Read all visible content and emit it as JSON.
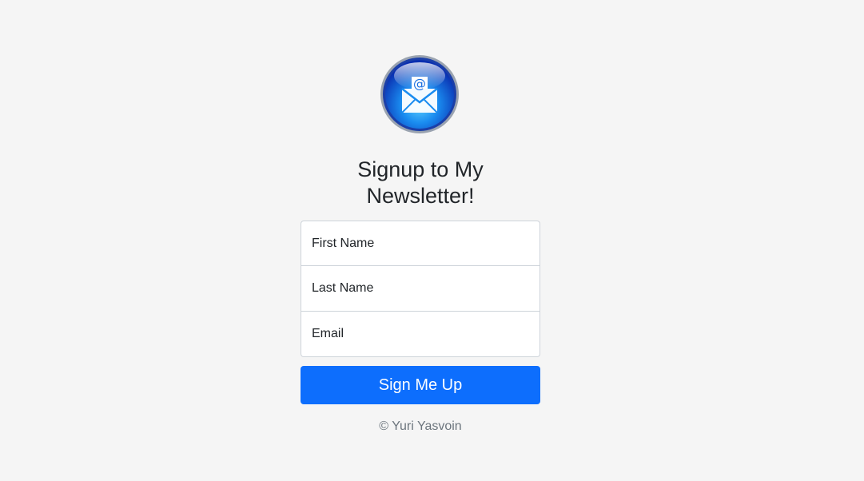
{
  "heading": {
    "line1": "Signup to My",
    "line2": "Newsletter!"
  },
  "form": {
    "first_name_placeholder": "First Name",
    "last_name_placeholder": "Last Name",
    "email_placeholder": "Email",
    "submit_label": "Sign Me Up"
  },
  "footer": {
    "text": "© Yuri Yasvoin"
  },
  "logo": {
    "icon": "newsletter-envelope-icon",
    "glyph": "@"
  },
  "colors": {
    "background": "#f5f5f5",
    "primary": "#0d6efd",
    "text": "#212529",
    "muted": "#6c757d"
  }
}
